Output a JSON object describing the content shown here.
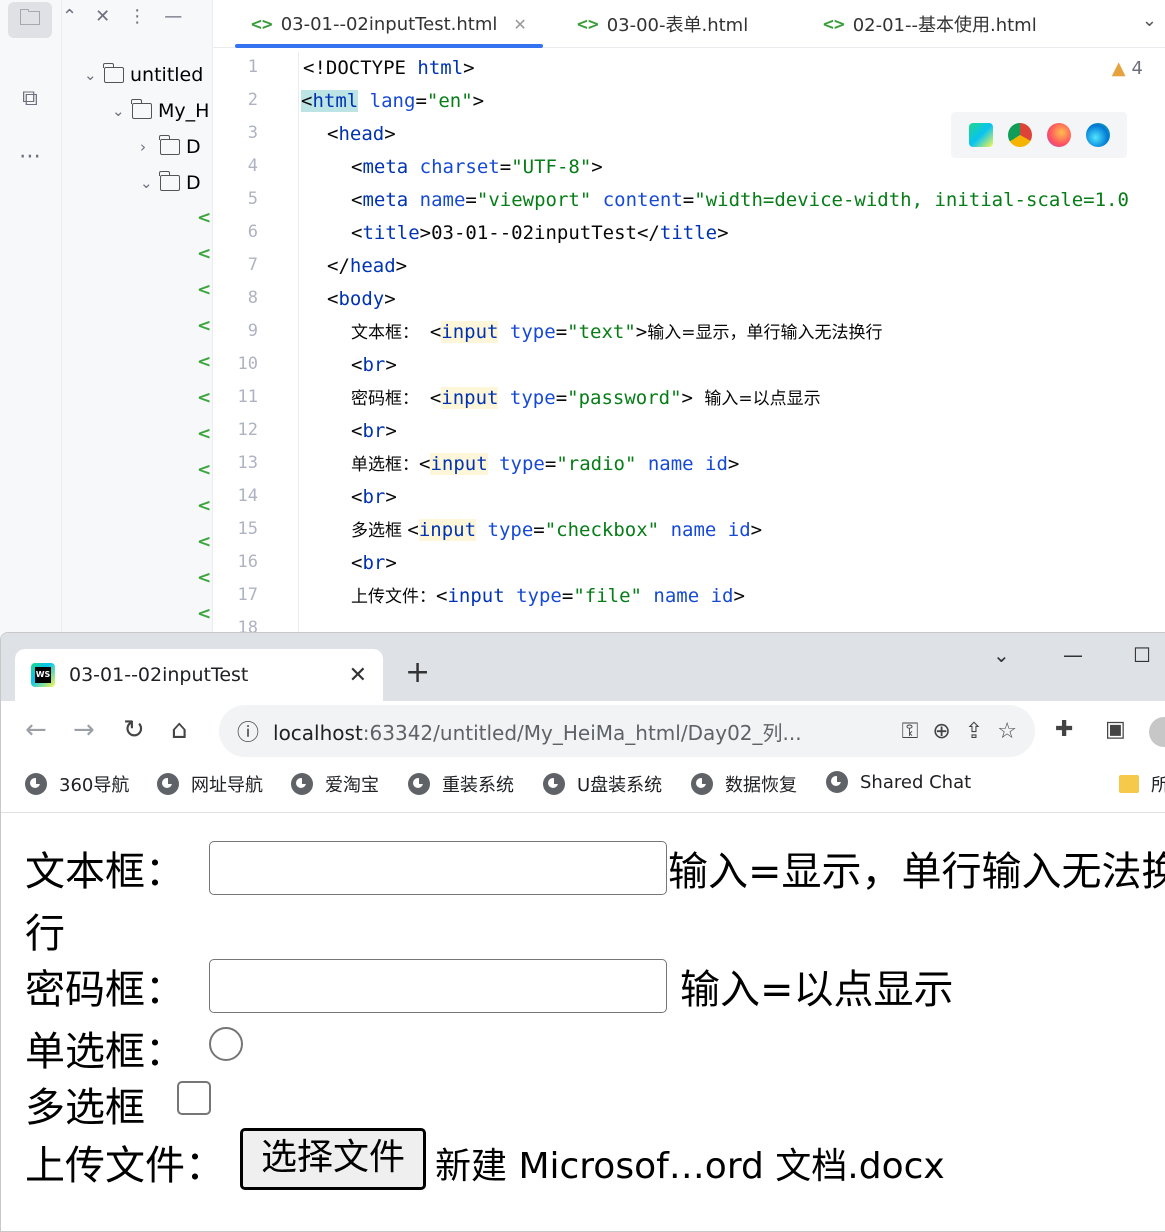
{
  "ide": {
    "tree": {
      "root": "untitled",
      "child": "My_H",
      "sub1": "D",
      "sub2": "D"
    },
    "tabs": [
      {
        "label": "03-01--02inputTest.html"
      },
      {
        "label": "03-00-表单.html"
      },
      {
        "label": "02-01--基本使用.html"
      }
    ],
    "warnings": "4",
    "line_numbers": [
      "1",
      "2",
      "3",
      "4",
      "5",
      "6",
      "7",
      "8",
      "9",
      "10",
      "11",
      "12",
      "13",
      "14",
      "15",
      "16",
      "17",
      "18"
    ]
  },
  "browser": {
    "tab_title": "03-01--02inputTest",
    "url_host": "localhost",
    "url_path": ":63342/untitled/My_HeiMa_html/Day02_列...",
    "bookmarks": [
      "360导航",
      "网址导航",
      "爱淘宝",
      "重装系统",
      "U盘装系统",
      "数据恢复",
      "Shared Chat"
    ],
    "bookmark_folder": "所",
    "page": {
      "text_label": "文本框：",
      "text_desc": "输入=显示，单行输入无法换",
      "text_wrap": "行",
      "pwd_label": "密码框：",
      "pwd_desc": "输入=以点显示",
      "radio_label": "单选框：",
      "check_label": "多选框",
      "file_label": "上传文件：",
      "file_button": "选择文件",
      "file_name": "新建 Microsof…ord 文档.docx"
    }
  }
}
